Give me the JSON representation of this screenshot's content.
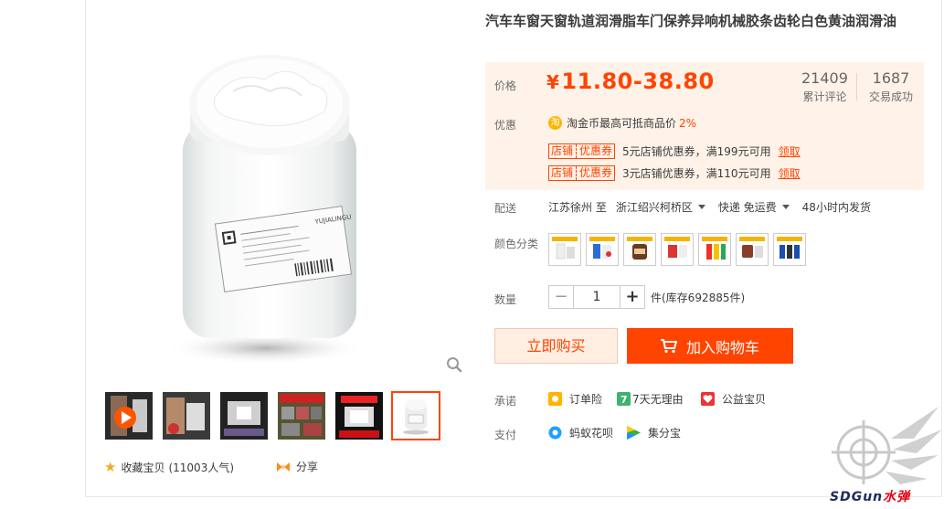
{
  "product": {
    "title": "汽车车窗天窗轨道润滑脂车门保养异响机械胶条齿轮白色黄油润滑油",
    "jar_label_text": "YUJIALINGU"
  },
  "price": {
    "label": "价格",
    "currency": "¥",
    "value": "11.80-38.80",
    "reviews_count": "21409",
    "reviews_label": "累计评论",
    "sales_count": "1687",
    "sales_label": "交易成功"
  },
  "promo": {
    "label": "优惠",
    "tao_icon": "淘",
    "coin_text": "淘金币最高可抵商品价",
    "coin_pct": "2%",
    "coupons": [
      {
        "tag_a": "店铺",
        "tag_b": "优惠券",
        "text": "5元店铺优惠券，满199元可用",
        "action": "领取"
      },
      {
        "tag_a": "店铺",
        "tag_b": "优惠券",
        "text": "3元店铺优惠券，满110元可用",
        "action": "领取"
      }
    ]
  },
  "shipping": {
    "label": "配送",
    "from": "江苏徐州 至",
    "to": "浙江绍兴柯桥区",
    "method": "快递 免运费",
    "dispatch": "48小时内发货"
  },
  "color": {
    "label": "颜色分类",
    "swatches": [
      "swatch-1",
      "swatch-2",
      "swatch-3",
      "swatch-4",
      "swatch-5",
      "swatch-6",
      "swatch-7"
    ]
  },
  "quantity": {
    "label": "数量",
    "minus": "−",
    "value": "1",
    "plus": "+",
    "stock": "件(库存692885件)"
  },
  "actions": {
    "buy_now": "立即购买",
    "add_cart": "加入购物车"
  },
  "promise": {
    "label": "承诺",
    "items": [
      "订单险",
      "7天无理由",
      "公益宝贝"
    ],
    "seven_badge": "7"
  },
  "payment": {
    "label": "支付",
    "items": [
      "蚂蚁花呗",
      "集分宝"
    ]
  },
  "gallery": {
    "favorite": "收藏宝贝",
    "popularity": "(11003人气)",
    "share": "分享"
  },
  "watermark": {
    "text_a": "SDGun",
    "text_b": "水弹"
  },
  "colors": {
    "accent": "#ff4400",
    "price_bg": "#fff2e8",
    "buy_bg": "#ffeee1"
  }
}
